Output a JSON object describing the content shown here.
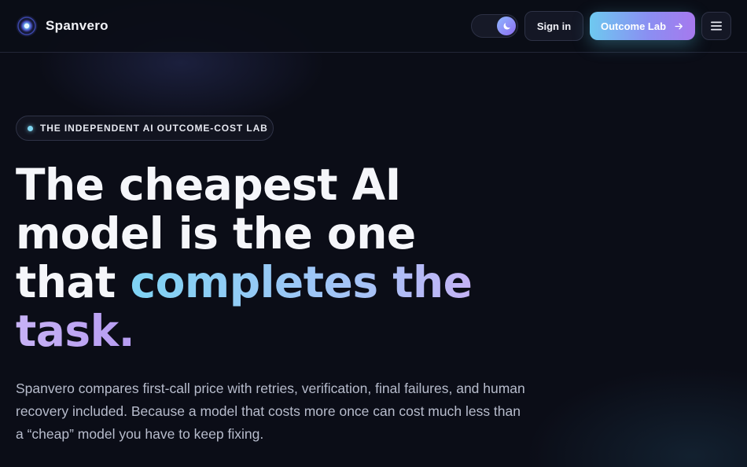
{
  "header": {
    "brand_name": "Spanvero",
    "sign_in_label": "Sign in",
    "cta_label": "Outcome Lab"
  },
  "icons": {
    "logo": "spanvero-orb-logo",
    "theme": "moon-icon",
    "cta_arrow": "arrow-right-icon",
    "menu": "hamburger-menu-icon"
  },
  "colors": {
    "background": "#0b0d17",
    "accent_cyan": "#7fd3f4",
    "accent_violet": "#a679ee",
    "text_primary": "#f5f6fa",
    "text_muted": "#b7bccc"
  },
  "hero": {
    "badge": "THE INDEPENDENT AI OUTCOME-COST LAB",
    "headline_plain": "The cheapest AI model is the one that ",
    "headline_accent_1": "completes the",
    "headline_accent_2": "task.",
    "description": "Spanvero compares first-call price with retries, verification, final failures, and human recovery included. Because a model that costs more once can cost much less than a “cheap” model you have to keep fixing."
  }
}
